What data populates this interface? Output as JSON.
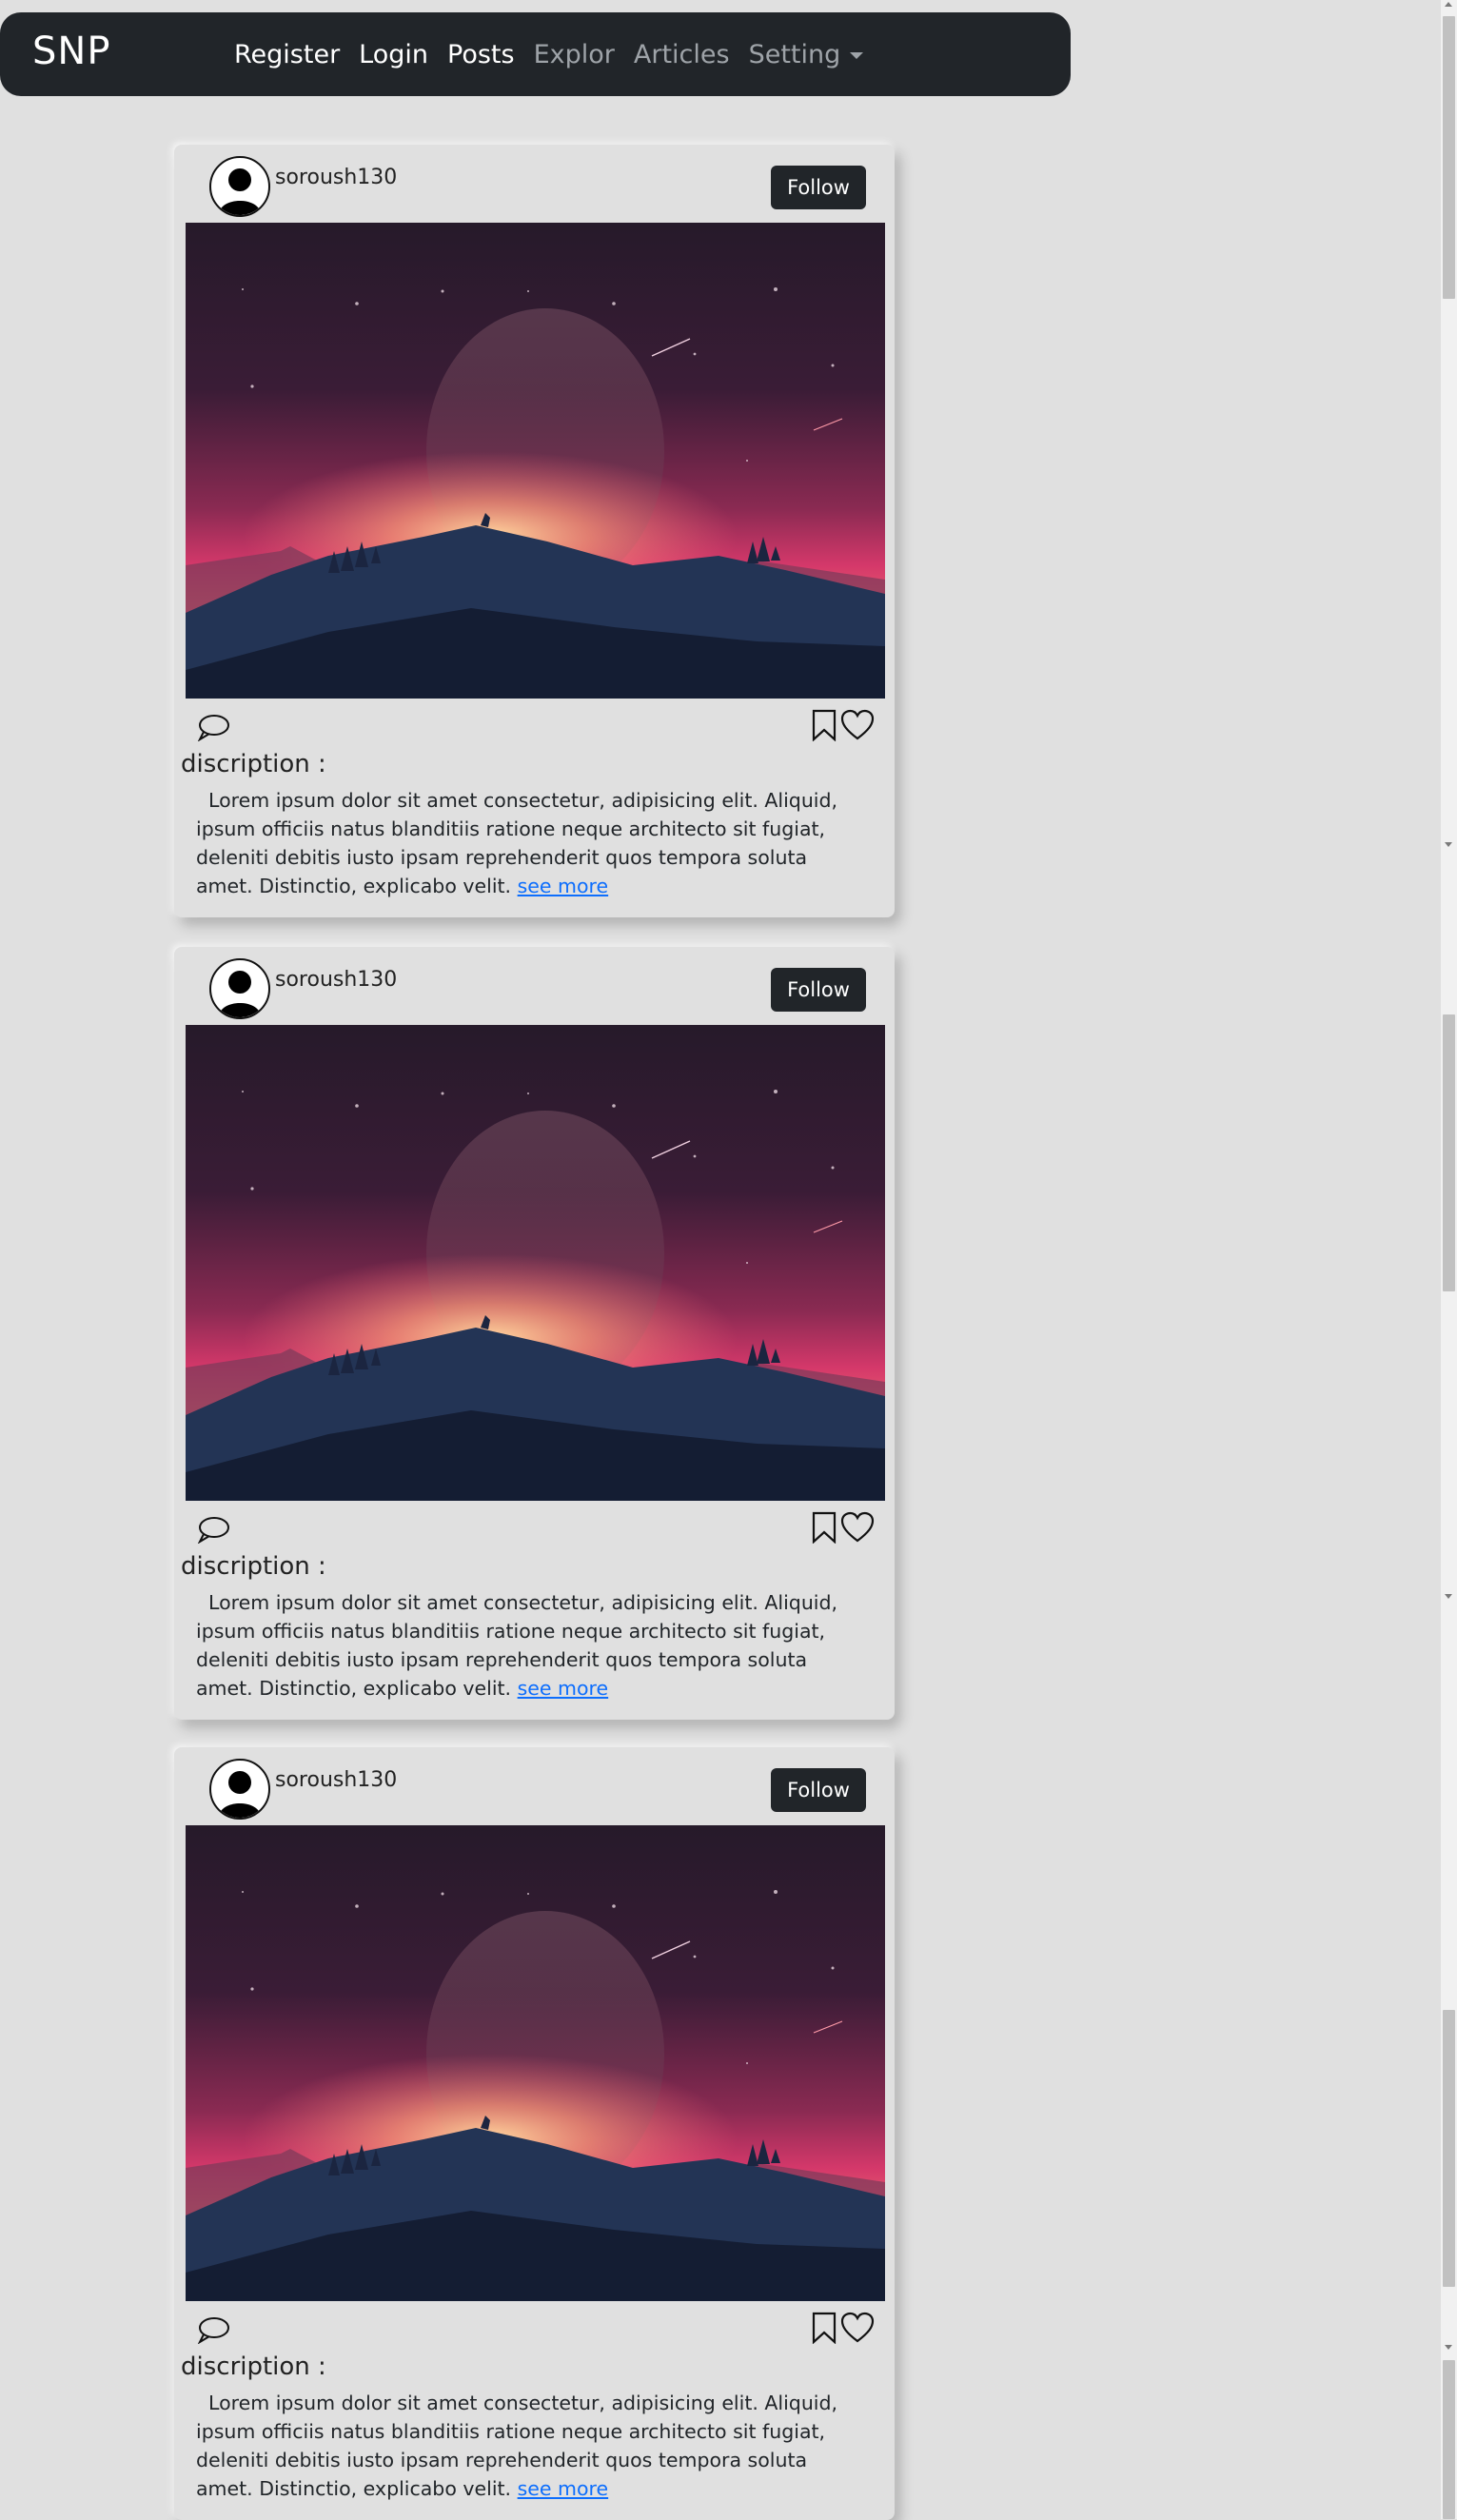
{
  "navbar": {
    "brand": "SNP",
    "links": [
      {
        "label": "Register",
        "state": "active"
      },
      {
        "label": "Login",
        "state": "active"
      },
      {
        "label": "Posts",
        "state": "active"
      },
      {
        "label": "Explor",
        "state": "muted"
      },
      {
        "label": "Articles",
        "state": "muted"
      },
      {
        "label": "Setting",
        "state": "muted",
        "dropdown": true
      }
    ]
  },
  "posts": [
    {
      "username": "soroush130",
      "follow_label": "Follow",
      "description_heading": "discription :",
      "description_text": "Lorem ipsum dolor sit amet consectetur, adipisicing elit. Aliquid, ipsum officiis natus blanditiis ratione neque architecto sit fugiat, deleniti debitis iusto ipsam reprehenderit quos tempora soluta amet. Distinctio, explicabo velit.",
      "see_more": "see more"
    },
    {
      "username": "soroush130",
      "follow_label": "Follow",
      "description_heading": "discription :",
      "description_text": "Lorem ipsum dolor sit amet consectetur, adipisicing elit. Aliquid, ipsum officiis natus blanditiis ratione neque architecto sit fugiat, deleniti debitis iusto ipsam reprehenderit quos tempora soluta amet. Distinctio, explicabo velit.",
      "see_more": "see more"
    },
    {
      "username": "soroush130",
      "follow_label": "Follow",
      "description_heading": "discription :",
      "description_text": "Lorem ipsum dolor sit amet consectetur, adipisicing elit. Aliquid, ipsum officiis natus blanditiis ratione neque architecto sit fugiat, deleniti debitis iusto ipsam reprehenderit quos tempora soluta amet. Distinctio, explicabo velit.",
      "see_more": "see more"
    }
  ],
  "icons": {
    "comment": "comment-icon",
    "bookmark": "bookmark-icon",
    "like": "heart-icon",
    "avatar": "user-silhouette-icon"
  },
  "colors": {
    "background": "#e0e0e0",
    "navbar": "#212529",
    "link": "#0d6efd",
    "button": "#212529"
  }
}
